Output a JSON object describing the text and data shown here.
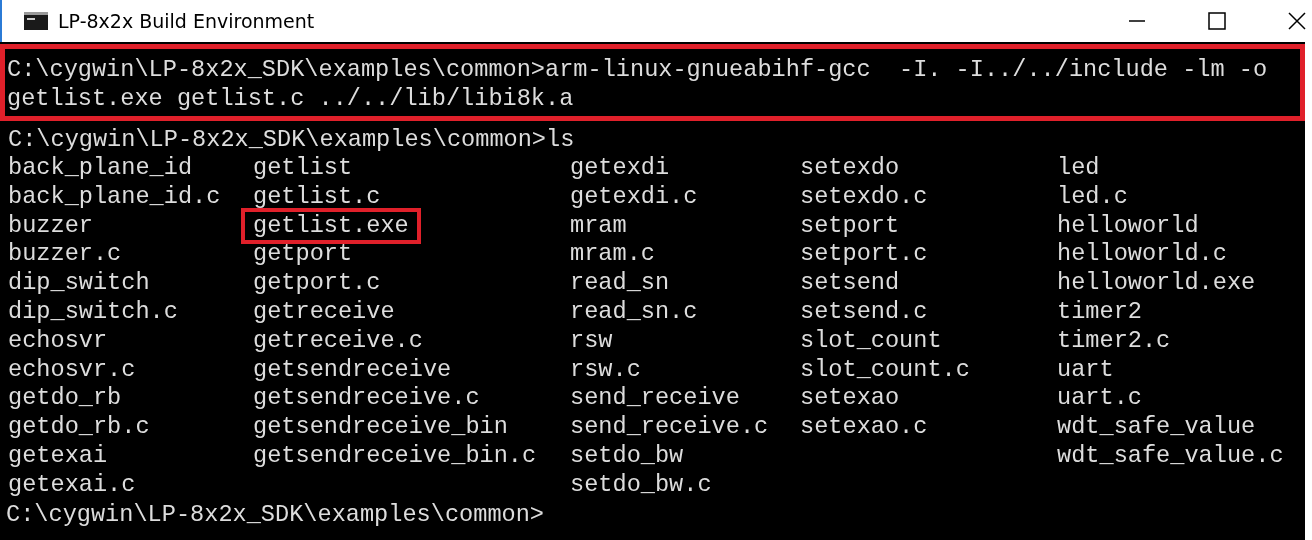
{
  "window": {
    "title": "LP-8x2x Build Environment"
  },
  "console": {
    "command_block": {
      "highlighted": true,
      "lines": [
        "C:\\cygwin\\LP-8x2x_SDK\\examples\\common>arm-linux-gnueabihf-gcc  -I. -I../../include -lm -o",
        "getlist.exe getlist.c ../../lib/libi8k.a"
      ]
    },
    "ls_command": "C:\\cygwin\\LP-8x2x_SDK\\examples\\common>ls",
    "listing_columns": [
      [
        {
          "name": "back_plane_id",
          "highlighted": false
        },
        {
          "name": "back_plane_id.c",
          "highlighted": false
        },
        {
          "name": "buzzer",
          "highlighted": false
        },
        {
          "name": "buzzer.c",
          "highlighted": false
        },
        {
          "name": "dip_switch",
          "highlighted": false
        },
        {
          "name": "dip_switch.c",
          "highlighted": false
        },
        {
          "name": "echosvr",
          "highlighted": false
        },
        {
          "name": "echosvr.c",
          "highlighted": false
        },
        {
          "name": "getdo_rb",
          "highlighted": false
        },
        {
          "name": "getdo_rb.c",
          "highlighted": false
        },
        {
          "name": "getexai",
          "highlighted": false
        },
        {
          "name": "getexai.c",
          "highlighted": false
        }
      ],
      [
        {
          "name": "getlist",
          "highlighted": false
        },
        {
          "name": "getlist.c",
          "highlighted": false
        },
        {
          "name": "getlist.exe",
          "highlighted": true
        },
        {
          "name": "getport",
          "highlighted": false
        },
        {
          "name": "getport.c",
          "highlighted": false
        },
        {
          "name": "getreceive",
          "highlighted": false
        },
        {
          "name": "getreceive.c",
          "highlighted": false
        },
        {
          "name": "getsendreceive",
          "highlighted": false
        },
        {
          "name": "getsendreceive.c",
          "highlighted": false
        },
        {
          "name": "getsendreceive_bin",
          "highlighted": false
        },
        {
          "name": "getsendreceive_bin.c",
          "highlighted": false
        }
      ],
      [
        {
          "name": "getexdi",
          "highlighted": false
        },
        {
          "name": "getexdi.c",
          "highlighted": false
        },
        {
          "name": "mram",
          "highlighted": false
        },
        {
          "name": "mram.c",
          "highlighted": false
        },
        {
          "name": "read_sn",
          "highlighted": false
        },
        {
          "name": "read_sn.c",
          "highlighted": false
        },
        {
          "name": "rsw",
          "highlighted": false
        },
        {
          "name": "rsw.c",
          "highlighted": false
        },
        {
          "name": "send_receive",
          "highlighted": false
        },
        {
          "name": "send_receive.c",
          "highlighted": false
        },
        {
          "name": "setdo_bw",
          "highlighted": false
        },
        {
          "name": "setdo_bw.c",
          "highlighted": false
        }
      ],
      [
        {
          "name": "setexdo",
          "highlighted": false
        },
        {
          "name": "setexdo.c",
          "highlighted": false
        },
        {
          "name": "setport",
          "highlighted": false
        },
        {
          "name": "setport.c",
          "highlighted": false
        },
        {
          "name": "setsend",
          "highlighted": false
        },
        {
          "name": "setsend.c",
          "highlighted": false
        },
        {
          "name": "slot_count",
          "highlighted": false
        },
        {
          "name": "slot_count.c",
          "highlighted": false
        },
        {
          "name": "setexao",
          "highlighted": false
        },
        {
          "name": "setexao.c",
          "highlighted": false
        }
      ],
      [
        {
          "name": "led",
          "highlighted": false
        },
        {
          "name": "led.c",
          "highlighted": false
        },
        {
          "name": "helloworld",
          "highlighted": false
        },
        {
          "name": "helloworld.c",
          "highlighted": false
        },
        {
          "name": "helloworld.exe",
          "highlighted": false
        },
        {
          "name": "timer2",
          "highlighted": false
        },
        {
          "name": "timer2.c",
          "highlighted": false
        },
        {
          "name": "uart",
          "highlighted": false
        },
        {
          "name": "uart.c",
          "highlighted": false
        },
        {
          "name": "wdt_safe_value",
          "highlighted": false
        },
        {
          "name": "wdt_safe_value.c",
          "highlighted": false
        }
      ]
    ],
    "prompt": "C:\\cygwin\\LP-8x2x_SDK\\examples\\common>"
  }
}
